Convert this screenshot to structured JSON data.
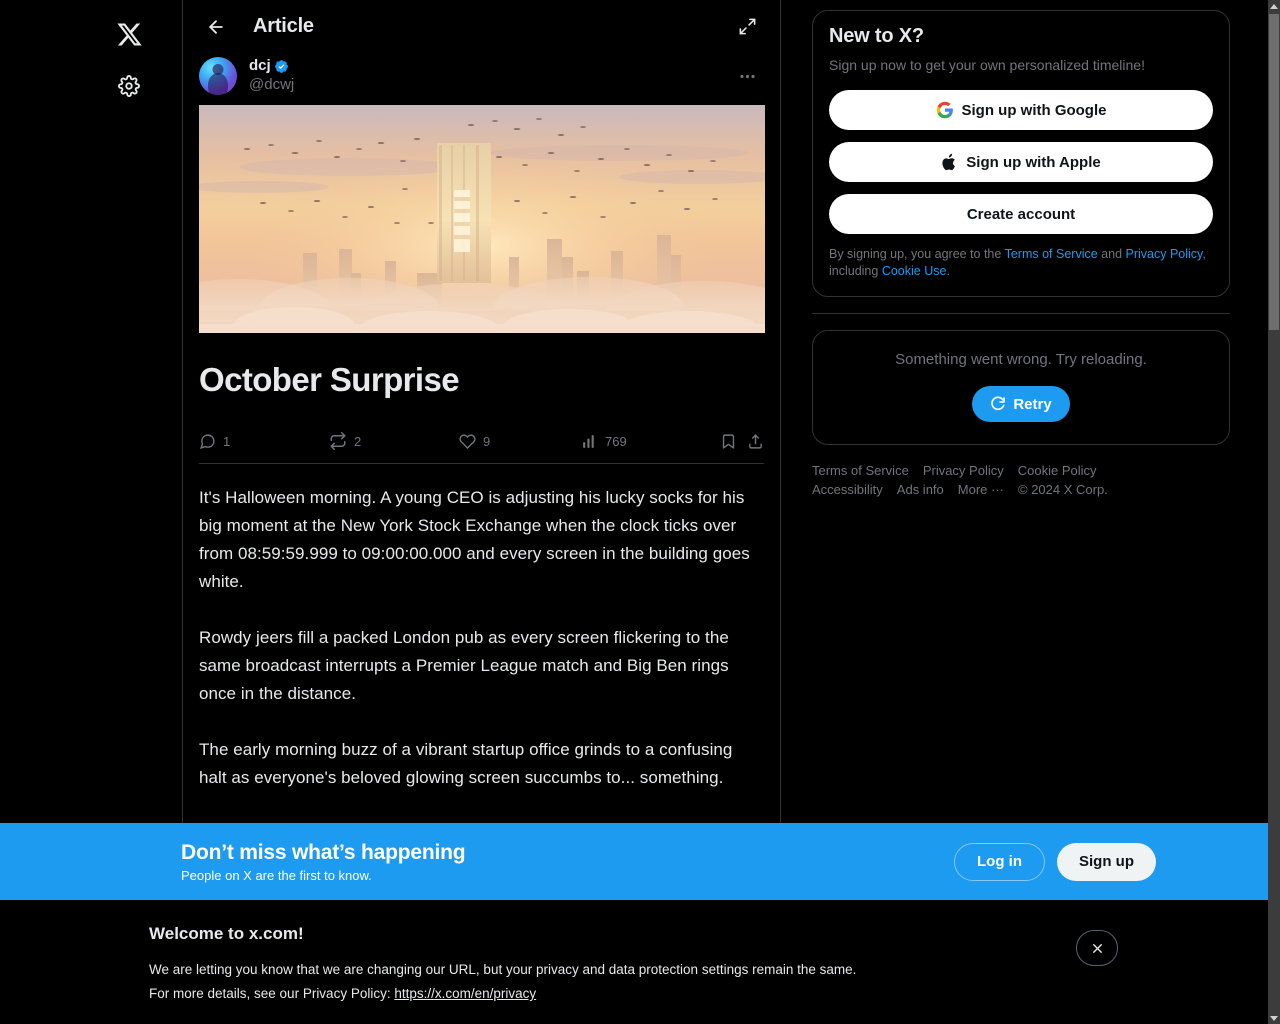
{
  "left_rail": {
    "logo_icon": "x-logo-icon",
    "settings_icon": "gear-icon"
  },
  "header": {
    "back_icon": "arrow-left-icon",
    "title": "Article",
    "expand_icon": "expand-arrows-icon"
  },
  "author": {
    "display_name": "dcj",
    "verified_icon": "verified-badge-icon",
    "handle": "@dcwj",
    "more_icon": "more-horizontal-icon"
  },
  "article": {
    "hero_image_alt": "sunset-city-skyline-above-clouds",
    "title": "October Surprise",
    "paragraphs": [
      "It's Halloween morning. A young CEO is adjusting his lucky socks for his big moment at the New York Stock Exchange when the clock ticks over from 08:59:59.999 to 09:00:00.000 and every screen in the building goes white.",
      "Rowdy jeers fill a packed London pub as every screen flickering to the same broadcast interrupts a Premier League match and Big Ben rings once in the distance.",
      "The early morning buzz of a vibrant startup office grinds to a confusing halt as everyone's beloved glowing screen succumbs to... something."
    ]
  },
  "metrics": {
    "reply": {
      "icon": "reply-bubble-icon",
      "count": "1"
    },
    "repost": {
      "icon": "repost-arrows-icon",
      "count": "2"
    },
    "like": {
      "icon": "heart-icon",
      "count": "9"
    },
    "views": {
      "icon": "analytics-bars-icon",
      "count": "769"
    },
    "bookmark_icon": "bookmark-icon",
    "share_icon": "share-upload-icon"
  },
  "signup_panel": {
    "title": "New to X?",
    "subtitle": "Sign up now to get your own personalized timeline!",
    "google_button": "Sign up with Google",
    "google_icon": "google-g-icon",
    "apple_button": "Sign up with Apple",
    "apple_icon": "apple-logo-icon",
    "create_button": "Create account",
    "legal_prefix": "By signing up, you agree to the ",
    "terms_link": "Terms of Service",
    "legal_and": " and ",
    "privacy_link": "Privacy Policy",
    "legal_including": ", including ",
    "cookie_link": "Cookie Use."
  },
  "error_panel": {
    "message": "Something went wrong. Try reloading.",
    "retry_label": "Retry",
    "retry_icon": "refresh-icon"
  },
  "footer_links": [
    "Terms of Service",
    "Privacy Policy",
    "Cookie Policy",
    "Accessibility",
    "Ads info",
    "More ···",
    "© 2024 X Corp."
  ],
  "bottom_banner": {
    "title": "Don’t miss what’s happening",
    "subtitle": "People on X are the first to know.",
    "login_label": "Log in",
    "signup_label": "Sign up"
  },
  "cookie_notice": {
    "title": "Welcome to x.com!",
    "line1": "We are letting you know that we are changing our URL, but your privacy and data protection settings remain the same.",
    "line2_prefix": "For more details, see our Privacy Policy: ",
    "link": "https://x.com/en/privacy",
    "close_icon": "close-x-icon"
  },
  "colors": {
    "accent_blue": "#1d9bf0",
    "background": "#000000",
    "border": "#2f3336",
    "muted_text": "#71767b",
    "primary_text": "#e7e9ea"
  }
}
